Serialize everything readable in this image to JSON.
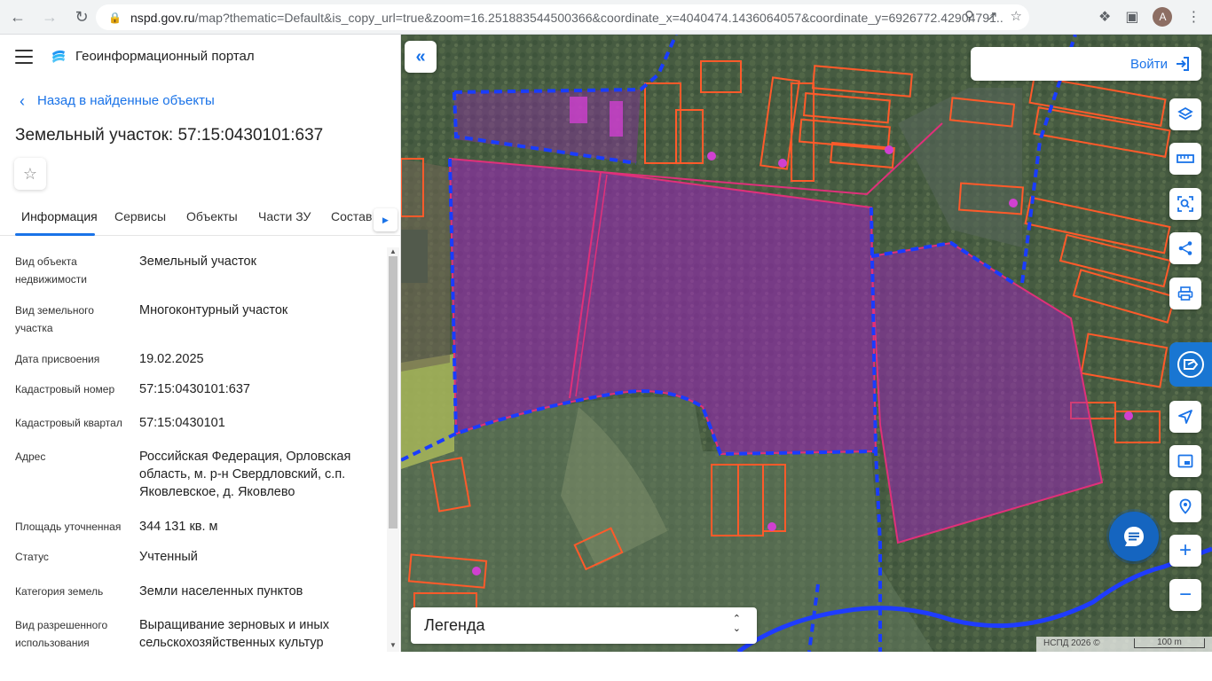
{
  "browser": {
    "url_host": "nspd.gov.ru",
    "url_rest": "/map?thematic=Default&is_copy_url=true&zoom=16.251883544500366&coordinate_x=4040474.1436064057&coordinate_y=6926772.42904791...",
    "avatar_letter": "A"
  },
  "header": {
    "portal_title": "Геоинформационный портал"
  },
  "back_link": "Назад в найденные объекты",
  "object_title": "Земельный участок: 57:15:0430101:637",
  "tabs": [
    {
      "label": "Информация"
    },
    {
      "label": "Сервисы"
    },
    {
      "label": "Объекты"
    },
    {
      "label": "Части ЗУ"
    },
    {
      "label": "Состав"
    }
  ],
  "properties": [
    {
      "label": "Вид объекта недвижимости",
      "value": "Земельный участок"
    },
    {
      "label": "Вид земельного участка",
      "value": "Многоконтурный участок"
    },
    {
      "label": "Дата присвоения",
      "value": "19.02.2025"
    },
    {
      "label": "Кадастровый номер",
      "value": "57:15:0430101:637"
    },
    {
      "label": "Кадастровый квартал",
      "value": "57:15:0430101"
    },
    {
      "label": "Адрес",
      "value": "Российская Федерация, Орловская область, м. р-н Свердловский, с.п. Яковлевское, д. Яковлево"
    },
    {
      "label": "Площадь уточненная",
      "value": "344 131 кв. м"
    },
    {
      "label": "Статус",
      "value": "Учтенный"
    },
    {
      "label": "Категория земель",
      "value": "Земли населенных пунктов"
    },
    {
      "label": "Вид разрешенного использования",
      "value": "Выращивание зерновых и иных сельскохозяйственных культур"
    }
  ],
  "map": {
    "login_label": "Войти",
    "legend_label": "Легенда",
    "attribution": "НСПД 2026 ©",
    "scale_label": "100 m",
    "colors": {
      "parcel_fill": "#a020c0",
      "parcel_outline": "#e0307a",
      "boundary_dashed": "#1a3cff",
      "building_outline": "#ff5a2a",
      "accent": "#1a73e8"
    }
  }
}
